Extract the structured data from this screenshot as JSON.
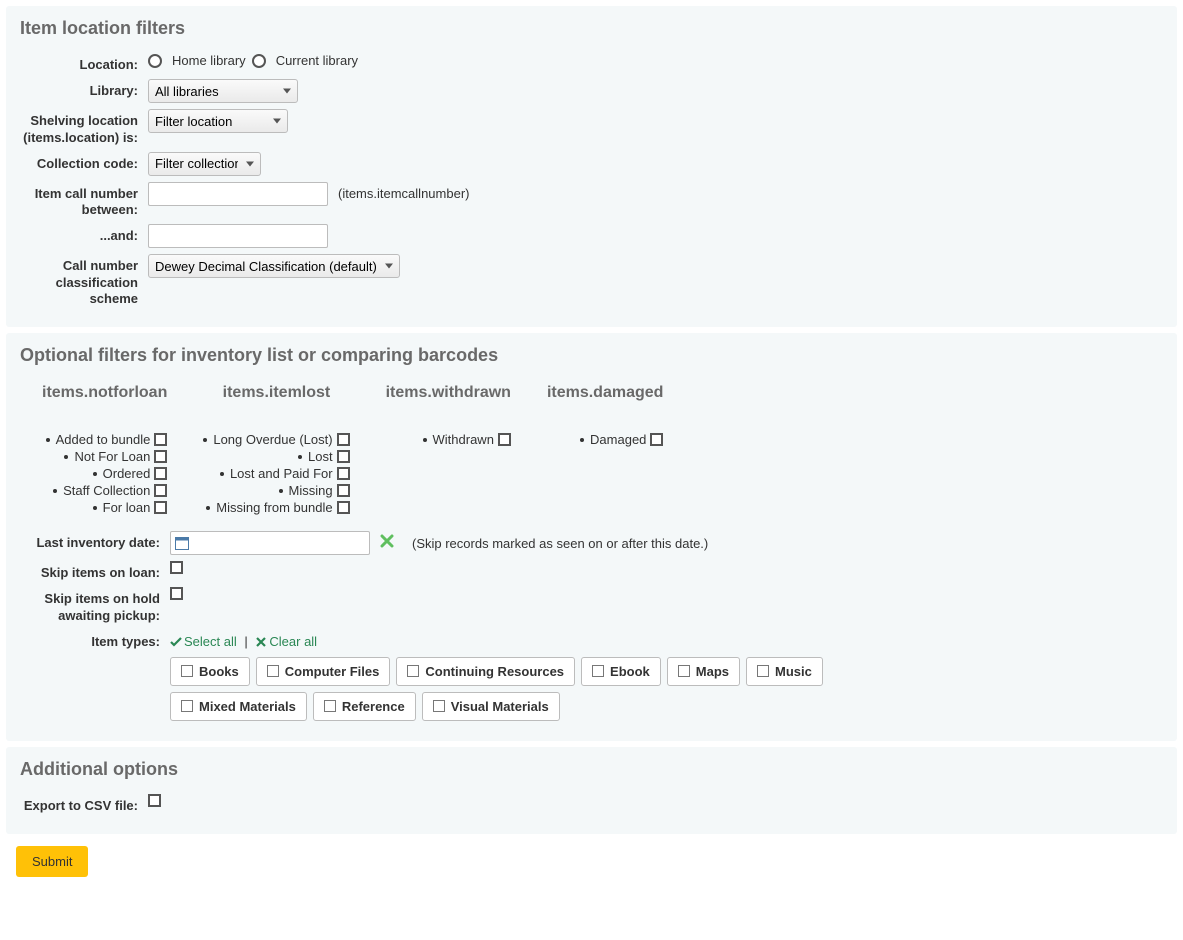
{
  "section1": {
    "legend": "Item location filters",
    "location_label": "Location:",
    "location_home": "Home library",
    "location_current": "Current library",
    "library_label": "Library:",
    "library_value": "All libraries",
    "shelving_label": "Shelving location (items.location) is:",
    "shelving_value": "Filter location",
    "collection_label": "Collection code:",
    "collection_value": "Filter collection",
    "callnum_from_label": "Item call number between:",
    "callnum_hint": "(items.itemcallnumber)",
    "callnum_to_label": "...and:",
    "scheme_label": "Call number classification scheme",
    "scheme_value": "Dewey Decimal Classification (default)"
  },
  "section2": {
    "legend": "Optional filters for inventory list or comparing barcodes",
    "columns": [
      {
        "header": "items.notforloan",
        "items": [
          "Added to bundle",
          "Not For Loan",
          "Ordered",
          "Staff Collection",
          "For loan"
        ]
      },
      {
        "header": "items.itemlost",
        "items": [
          "Long Overdue (Lost)",
          "Lost",
          "Lost and Paid For",
          "Missing",
          "Missing from bundle"
        ]
      },
      {
        "header": "items.withdrawn",
        "items": [
          "Withdrawn"
        ]
      },
      {
        "header": "items.damaged",
        "items": [
          "Damaged"
        ]
      }
    ],
    "lastinv_label": "Last inventory date:",
    "lastinv_hint": "(Skip records marked as seen on or after this date.)",
    "skip_loan_label": "Skip items on loan:",
    "skip_hold_label": "Skip items on hold awaiting pickup:",
    "itemtypes_label": "Item types:",
    "select_all": "Select all",
    "clear_all": "Clear all",
    "itemtypes": [
      "Books",
      "Computer Files",
      "Continuing Resources",
      "Ebook",
      "Maps",
      "Music",
      "Mixed Materials",
      "Reference",
      "Visual Materials"
    ]
  },
  "section3": {
    "legend": "Additional options",
    "export_label": "Export to CSV file:"
  },
  "submit_label": "Submit"
}
